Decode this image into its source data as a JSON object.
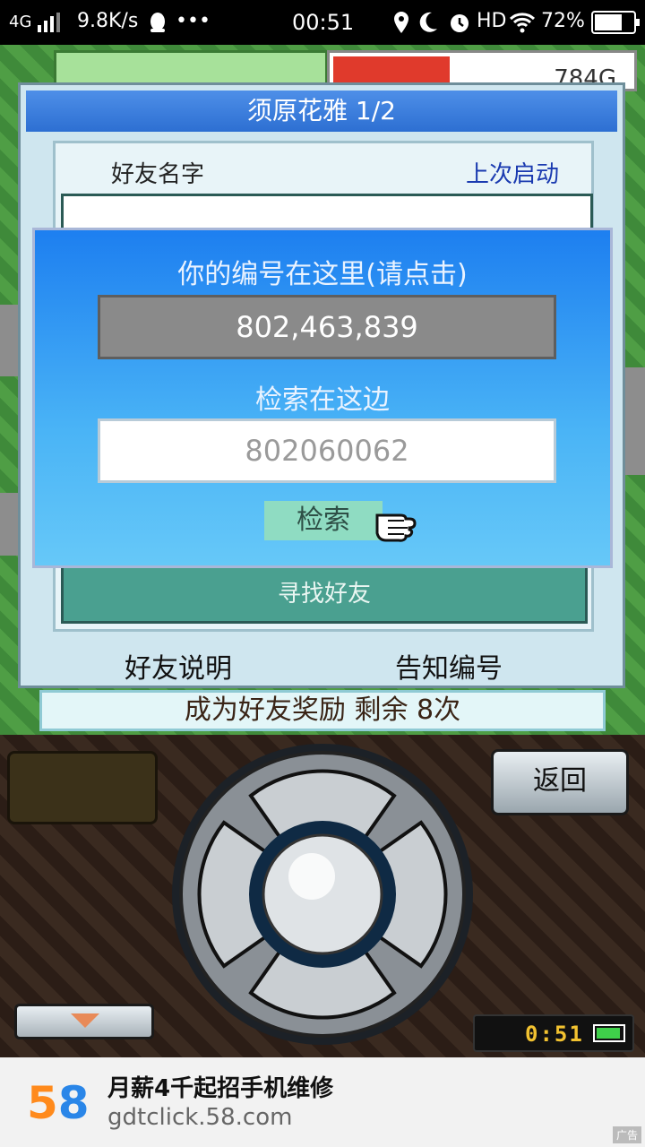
{
  "status_bar": {
    "network": "4G",
    "speed": "9.8K/s",
    "dots": "•••",
    "time": "00:51",
    "hd": "HD",
    "battery": "72%",
    "battery_level": 0.72
  },
  "hud": {
    "gold": "784G"
  },
  "dialog": {
    "title": "须原花雅 1/2",
    "col_name": "好友名字",
    "col_last": "上次启动",
    "find_button": "寻找好友",
    "friend_help": "好友说明",
    "tell_number": "告知编号"
  },
  "reward_text": "成为好友奖励 剩余 8次",
  "overlay": {
    "title": "你的编号在这里(请点击)",
    "my_id": "802,463,839",
    "search_label": "检索在这边",
    "search_value": "802060062",
    "search_button": "检索"
  },
  "controls": {
    "back_button": "返回",
    "clock": "0:51"
  },
  "ad": {
    "logo_5": "5",
    "logo_8": "8",
    "title": "月薪4千起招手机维修",
    "url": "gdtclick.58.com",
    "tag": "广告"
  }
}
